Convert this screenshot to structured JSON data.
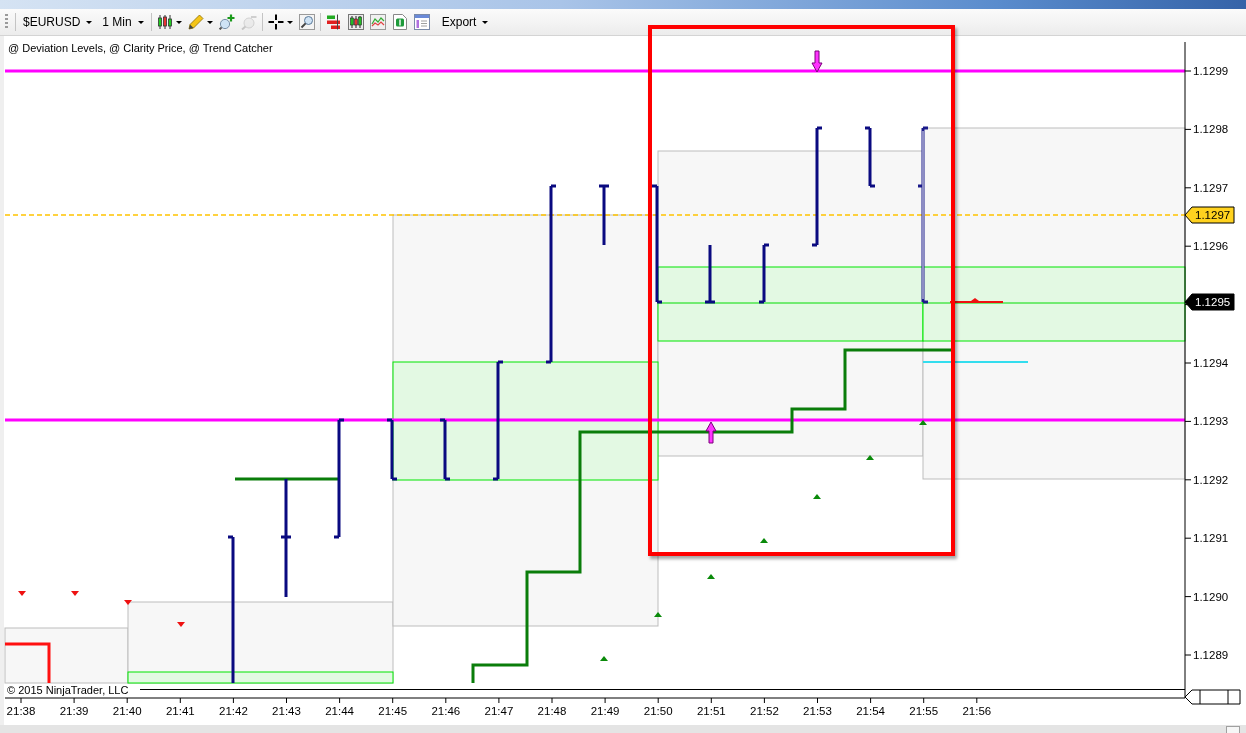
{
  "toolbar": {
    "groups": [
      {
        "items": [
          {
            "kind": "dropdown",
            "label": "$EURUSD"
          },
          {
            "kind": "dropdown",
            "label": "1 Min"
          }
        ]
      },
      {
        "items": [
          {
            "kind": "tool",
            "menu": true,
            "disabled": false
          },
          {
            "kind": "tool",
            "menu": true,
            "disabled": false
          },
          {
            "kind": "tool",
            "menu": false,
            "disabled": false
          },
          {
            "kind": "tool",
            "menu": false,
            "disabled": true
          }
        ]
      },
      {
        "items": [
          {
            "kind": "tool",
            "menu": true,
            "disabled": false
          },
          {
            "kind": "tool",
            "menu": false,
            "disabled": false
          }
        ]
      },
      {
        "items": [
          {
            "kind": "tool",
            "menu": false,
            "disabled": false
          },
          {
            "kind": "tool",
            "menu": false,
            "disabled": false
          },
          {
            "kind": "tool",
            "menu": false,
            "disabled": false
          },
          {
            "kind": "tool",
            "menu": false,
            "disabled": false
          },
          {
            "kind": "tool",
            "menu": false,
            "disabled": false
          },
          {
            "kind": "dropdown",
            "label": "Export"
          }
        ]
      }
    ]
  },
  "chart": {
    "legend": "@ Deviation Levels, @ Clarity Price, @ Trend Catcher",
    "price_axis": {
      "upper_labels": [
        "1.1299",
        "1.1298",
        "1.1297",
        "1.1296"
      ],
      "lower_labels": [
        "1.1294",
        "1.1293",
        "1.1292",
        "1.1291",
        "1.1290",
        "1.1289"
      ]
    },
    "price_tags": [
      {
        "kind": "level",
        "label": "1.1297"
      },
      {
        "kind": "last",
        "label": "1.1295"
      }
    ],
    "time_axis": [
      "21:38",
      "21:39",
      "21:40",
      "21:41",
      "21:42",
      "21:43",
      "21:44",
      "21:45",
      "21:46",
      "21:47",
      "21:48",
      "21:49",
      "21:50",
      "21:51",
      "21:52",
      "21:53",
      "21:54",
      "21:55",
      "21:56"
    ],
    "copyright": "© 2015 NinjaTrader, LLC"
  }
}
